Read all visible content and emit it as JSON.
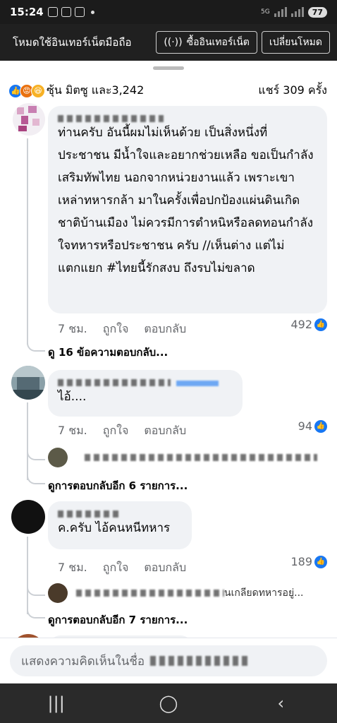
{
  "status": {
    "time": "15:24",
    "network": "5G",
    "battery": "77"
  },
  "banner": {
    "mode_text": "โหมดใช้อินเทอร์เน็ตมือถือ",
    "buy_button": "ซื้ออินเทอร์เน็ต",
    "switch_button": "เปลี่ยนโหมด"
  },
  "reactions": {
    "summary": "ซุ้น มิตซู และ3,242",
    "shares": "แชร์ 309 ครั้ง"
  },
  "comments": [
    {
      "text": "ท่านครับ อันนี้ผมไม่เห็นด้วย เป็นสิ่งหนึ่งที่ประชาชน มีน้ำใจและอยากช่วยเหลือ ขอเป็นกำลังเสริมทัพไทย นอกจากหน่วยงานแล้ว เพราะเขาเหล่าทหารกล้า มาในครั้งเพื่อปกป้องแผ่นดินเกิด ชาติบ้านเมือง ไม่ควรมีการตำหนิหรือลดทอนกำลังใจทหารหรือประชาชน ครับ //เห็นต่าง แต่ไม่แตกแยก #ไทยนี้รักสงบ ถึงรบไม่ขลาด",
      "time": "7 ชม.",
      "like": "ถูกใจ",
      "reply": "ตอบกลับ",
      "likes": "492",
      "view_replies": "ดู 16 ข้อความตอบกลับ..."
    },
    {
      "text": "ไอ้....",
      "time": "7 ชม.",
      "like": "ถูกใจ",
      "reply": "ตอบกลับ",
      "likes": "94",
      "view_replies": "ดูการตอบกลับอีก 6 รายการ..."
    },
    {
      "text": "ค.ครับ ไอ้คนหนีทหาร",
      "time": "7 ชม.",
      "like": "ถูกใจ",
      "reply": "ตอบกลับ",
      "likes": "189",
      "reply_preview": "นเกลียดทหารอยู่...",
      "view_replies": "ดูการตอบกลับอีก 7 รายการ..."
    }
  ],
  "input": {
    "placeholder": "แสดงความคิดเห็นในชื่อ"
  },
  "colors": {
    "accent": "#1877f2",
    "bubble": "#f0f2f5",
    "banner": "#202020"
  }
}
